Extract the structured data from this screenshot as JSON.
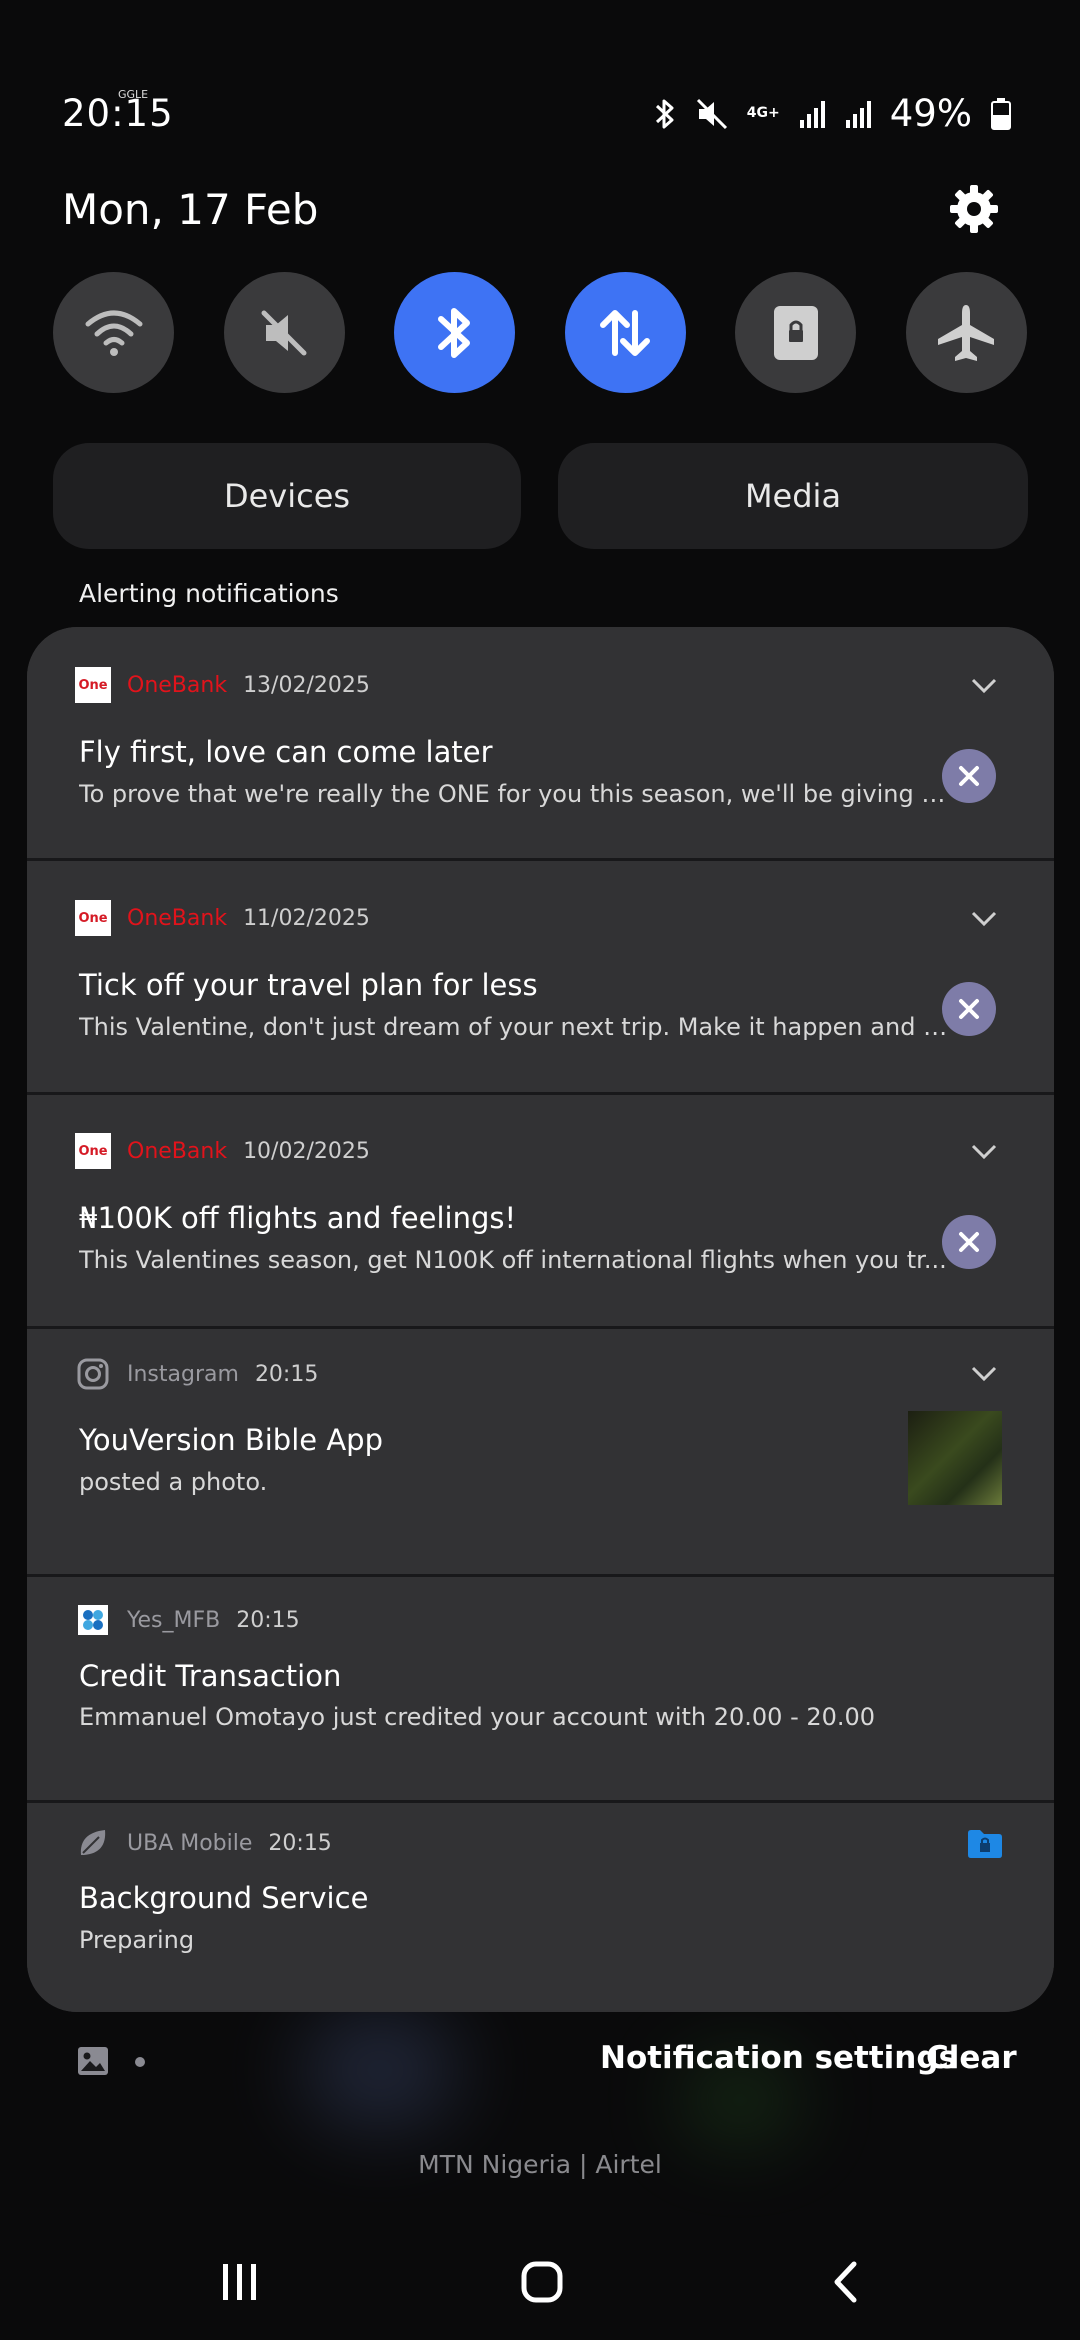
{
  "status": {
    "time": "20:15",
    "time_badge": "GGLE",
    "network": "4G+",
    "battery": "49%",
    "icons": [
      "bluetooth-icon",
      "mute-icon",
      "signal-icon",
      "signal-icon",
      "battery-icon"
    ]
  },
  "header": {
    "date": "Mon, 17 Feb"
  },
  "quick_settings": [
    {
      "name": "wifi",
      "icon": "wifi-icon",
      "on": false
    },
    {
      "name": "sound",
      "icon": "mute-icon",
      "on": false
    },
    {
      "name": "bluetooth",
      "icon": "bluetooth-icon",
      "on": true
    },
    {
      "name": "mobile-data",
      "icon": "data-icon",
      "on": true
    },
    {
      "name": "rotation-lock",
      "icon": "lock-icon",
      "on": false
    },
    {
      "name": "airplane-mode",
      "icon": "airplane-icon",
      "on": false
    }
  ],
  "buttons": {
    "devices": "Devices",
    "media": "Media"
  },
  "section_label": "Alerting notifications",
  "notifications": [
    {
      "app": "OneBank",
      "app_icon_text": "One",
      "time": "13/02/2025",
      "title": "Fly first, love can come later",
      "body": "To prove that we're really the ONE for you this season, we'll be giving you..."
    },
    {
      "app": "OneBank",
      "app_icon_text": "One",
      "time": "11/02/2025",
      "title": "Tick off your travel plan for less",
      "body": "This Valentine, don't just dream of your next trip. Make it happen and g..."
    },
    {
      "app": "OneBank",
      "app_icon_text": "One",
      "time": "10/02/2025",
      "title": "₦100K off flights and feelings!",
      "body": "This Valentines season, get N100K off international flights when you tr..."
    },
    {
      "app": "Instagram",
      "time": "20:15",
      "title": "YouVersion Bible App",
      "body": "posted a photo."
    },
    {
      "app": "Yes_MFB",
      "time": "20:15",
      "title": "Credit Transaction",
      "body": "Emmanuel Omotayo just credited your account with 20.00 - 20.00"
    },
    {
      "app": "UBA Mobile",
      "time": "20:15",
      "title": "Background Service",
      "body": "Preparing"
    }
  ],
  "footer": {
    "settings": "Notification settings",
    "clear": "Clear",
    "carrier": "MTN Nigeria | Airtel"
  },
  "colors": {
    "accent": "#3e73f4",
    "onebank_red": "#e1131b",
    "dismiss": "#7e7ca8",
    "folder_blue": "#1e88e5"
  }
}
